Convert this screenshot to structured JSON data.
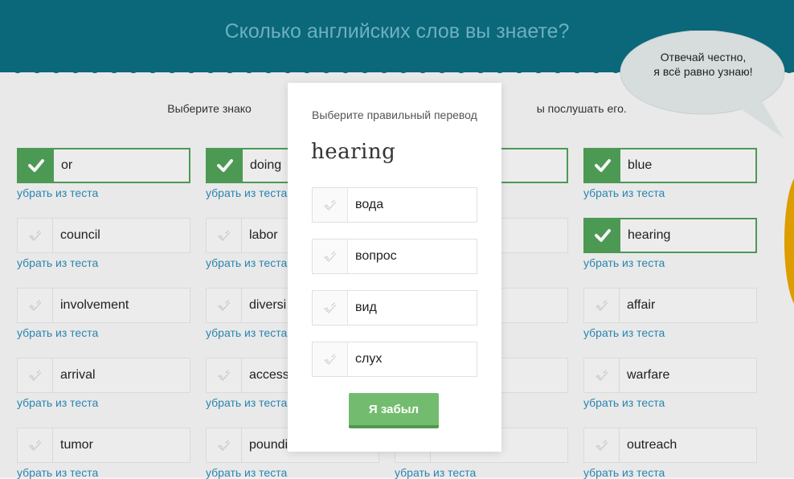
{
  "header": {
    "title": "Сколько английских слов вы знаете?"
  },
  "bubble": {
    "line1": "Отвечай честно,",
    "line2": "я всё равно узнаю!"
  },
  "instruction": {
    "visible_left": "Выберите знако",
    "visible_right": "ы послушать его."
  },
  "remove_label": "убрать из теста",
  "words": [
    {
      "word": "or",
      "known": true
    },
    {
      "word": "doing",
      "known": true
    },
    {
      "word": "",
      "known": true
    },
    {
      "word": "blue",
      "known": true
    },
    {
      "word": "council",
      "known": false
    },
    {
      "word": "labor",
      "known": false
    },
    {
      "word": "",
      "known": false
    },
    {
      "word": "hearing",
      "known": true
    },
    {
      "word": "involvement",
      "known": false
    },
    {
      "word": "diversi",
      "known": false
    },
    {
      "word": "",
      "known": false
    },
    {
      "word": "affair",
      "known": false
    },
    {
      "word": "arrival",
      "known": false
    },
    {
      "word": "access",
      "known": false
    },
    {
      "word": "",
      "known": false
    },
    {
      "word": "warfare",
      "known": false
    },
    {
      "word": "tumor",
      "known": false
    },
    {
      "word": "poundi",
      "known": false
    },
    {
      "word": "",
      "known": false
    },
    {
      "word": "outreach",
      "known": false
    }
  ],
  "modal": {
    "instruction": "Выберите правильный перевод",
    "word": "hearing",
    "options": [
      "вода",
      "вопрос",
      "вид",
      "слух"
    ],
    "forgot_button": "Я забыл"
  },
  "colors": {
    "header": "#0c6b7f",
    "header_text": "#6fb8c6",
    "accent_green": "#4f9f58",
    "button_green": "#73bc6f",
    "link_blue": "#2a8ab7"
  }
}
